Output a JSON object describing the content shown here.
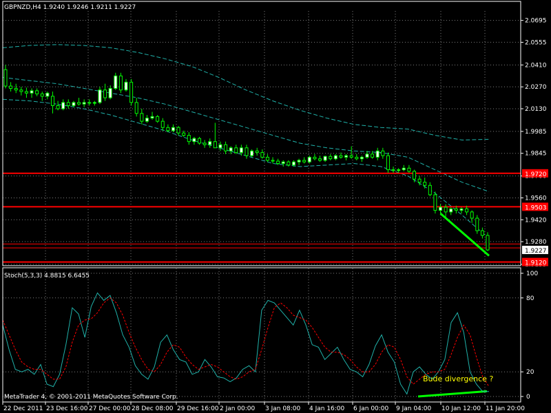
{
  "main_header": "GBPNZD,H4  1.9240 1.9246 1.9211 1.9227",
  "stoch_header": "Stoch(5,3,3) 4.8815 6.6455",
  "copyright": "MetaTrader 4, © 2001-2011 MetaQuotes Software Corp.",
  "annotation": "Bude divergence ?",
  "colors": {
    "background": "#000000",
    "grid": "#808080",
    "bull_candle": "#ffffff",
    "bear_candle": "#000000",
    "wick": "#00ff00",
    "bands": "#20b2aa",
    "level_line": "#ff0000",
    "trend_line": "#00ff00",
    "stoch_main": "#20b2aa",
    "stoch_signal": "#ff0000",
    "annotation": "#ffff00"
  },
  "chart_data": [
    {
      "type": "candlestick",
      "symbol": "GBPNZD",
      "timeframe": "H4",
      "ylim": [
        1.9135,
        2.0755
      ],
      "y_ticks": [
        "2.0695",
        "2.0555",
        "2.0410",
        "2.0270",
        "2.0130",
        "1.9985",
        "1.9845",
        "1.9700",
        "1.9560",
        "1.9420",
        "1.9280",
        "1.9135"
      ],
      "x_ticks": [
        "22 Dec 2011",
        "23 Dec 16:00",
        "27 Dec 00:00",
        "28 Dec 08:00",
        "29 Dec 16:00",
        "2 Jan 00:00",
        "3 Jan 08:00",
        "4 Jan 16:00",
        "6 Jan 00:00",
        "9 Jan 04:00",
        "10 Jan 12:00",
        "11 Jan 20:00"
      ],
      "price_labels": [
        "1.9720",
        "1.9503",
        "1.9227",
        "1.9120"
      ],
      "horizontal_levels": [
        1.9717,
        1.9503,
        1.9265,
        1.924,
        1.915
      ],
      "candles": [
        [
          2.038,
          2.041,
          2.026,
          2.0275
        ],
        [
          2.0275,
          2.03,
          2.024,
          2.026
        ],
        [
          2.026,
          2.029,
          2.023,
          2.025
        ],
        [
          2.025,
          2.027,
          2.0215,
          2.024
        ],
        [
          2.024,
          2.0265,
          2.02,
          2.023
        ],
        [
          2.023,
          2.026,
          2.02,
          2.0245
        ],
        [
          2.0245,
          2.026,
          2.021,
          2.0225
        ],
        [
          2.0225,
          2.024,
          2.018,
          2.021
        ],
        [
          2.021,
          2.024,
          2.019,
          2.023
        ],
        [
          2.021,
          2.024,
          2.01,
          2.015
        ],
        [
          2.015,
          2.018,
          2.012,
          2.013
        ],
        [
          2.013,
          2.019,
          2.012,
          2.017
        ],
        [
          2.017,
          2.019,
          2.013,
          2.015
        ],
        [
          2.015,
          2.018,
          2.014,
          2.017
        ],
        [
          2.017,
          2.02,
          2.015,
          2.016
        ],
        [
          2.016,
          2.019,
          2.014,
          2.017
        ],
        [
          2.017,
          2.019,
          2.015,
          2.0165
        ],
        [
          2.0165,
          2.018,
          2.015,
          2.017
        ],
        [
          2.017,
          2.027,
          2.016,
          2.025
        ],
        [
          2.025,
          2.029,
          2.018,
          2.02
        ],
        [
          2.02,
          2.028,
          2.019,
          2.026
        ],
        [
          2.026,
          2.036,
          2.025,
          2.034
        ],
        [
          2.034,
          2.036,
          2.023,
          2.025
        ],
        [
          2.025,
          2.032,
          2.024,
          2.03
        ],
        [
          2.03,
          2.032,
          2.015,
          2.017
        ],
        [
          2.017,
          2.02,
          2.008,
          2.01
        ],
        [
          2.01,
          2.013,
          2.003,
          2.005
        ],
        [
          2.005,
          2.009,
          2.004,
          2.007
        ],
        [
          2.007,
          2.011,
          2.006,
          2.008
        ],
        [
          2.008,
          2.009,
          2.004,
          2.005
        ],
        [
          2.005,
          2.007,
          1.999,
          2.001
        ],
        [
          2.001,
          2.003,
          1.998,
          1.999
        ],
        [
          1.999,
          2.003,
          1.998,
          2.001
        ],
        [
          2.001,
          2.002,
          1.996,
          1.9975
        ],
        [
          1.9975,
          1.999,
          1.995,
          1.996
        ],
        [
          1.996,
          1.998,
          1.99,
          1.992
        ],
        [
          1.992,
          1.995,
          1.99,
          1.994
        ],
        [
          1.994,
          1.995,
          1.99,
          1.991
        ],
        [
          1.991,
          1.993,
          1.988,
          1.99
        ],
        [
          1.99,
          1.994,
          1.988,
          1.992
        ],
        [
          1.992,
          2.004,
          1.988,
          1.988
        ],
        [
          1.988,
          1.992,
          1.986,
          1.99
        ],
        [
          1.99,
          1.992,
          1.984,
          1.986
        ],
        [
          1.986,
          1.989,
          1.984,
          1.988
        ],
        [
          1.988,
          1.99,
          1.984,
          1.985
        ],
        [
          1.985,
          1.99,
          1.983,
          1.988
        ],
        [
          1.988,
          1.99,
          1.981,
          1.983
        ],
        [
          1.983,
          1.987,
          1.982,
          1.986
        ],
        [
          1.986,
          1.988,
          1.983,
          1.985
        ],
        [
          1.985,
          1.987,
          1.981,
          1.982
        ],
        [
          1.982,
          1.984,
          1.979,
          1.98
        ],
        [
          1.98,
          1.982,
          1.978,
          1.9795
        ],
        [
          1.9795,
          1.981,
          1.977,
          1.978
        ],
        [
          1.978,
          1.98,
          1.976,
          1.979
        ],
        [
          1.979,
          1.98,
          1.976,
          1.977
        ],
        [
          1.977,
          1.98,
          1.976,
          1.979
        ],
        [
          1.979,
          1.981,
          1.977,
          1.98
        ],
        [
          1.98,
          1.982,
          1.978,
          1.979
        ],
        [
          1.979,
          1.983,
          1.978,
          1.982
        ],
        [
          1.982,
          1.984,
          1.98,
          1.981
        ],
        [
          1.981,
          1.983,
          1.979,
          1.98
        ],
        [
          1.98,
          1.983,
          1.979,
          1.9825
        ],
        [
          1.9825,
          1.984,
          1.98,
          1.981
        ],
        [
          1.981,
          1.984,
          1.98,
          1.983
        ],
        [
          1.983,
          1.985,
          1.981,
          1.982
        ],
        [
          1.982,
          1.984,
          1.98,
          1.983
        ],
        [
          1.983,
          1.989,
          1.981,
          1.982
        ],
        [
          1.982,
          1.984,
          1.98,
          1.981
        ],
        [
          1.981,
          1.983,
          1.979,
          1.982
        ],
        [
          1.982,
          1.986,
          1.981,
          1.984
        ],
        [
          1.984,
          1.986,
          1.981,
          1.982
        ],
        [
          1.982,
          1.988,
          1.98,
          1.986
        ],
        [
          1.986,
          1.988,
          1.981,
          1.983
        ],
        [
          1.983,
          1.985,
          1.972,
          1.974
        ],
        [
          1.974,
          1.976,
          1.972,
          1.9735
        ],
        [
          1.9735,
          1.975,
          1.972,
          1.974
        ],
        [
          1.974,
          1.977,
          1.973,
          1.975
        ],
        [
          1.975,
          1.977,
          1.972,
          1.973
        ],
        [
          1.973,
          1.974,
          1.966,
          1.968
        ],
        [
          1.968,
          1.97,
          1.964,
          1.966
        ],
        [
          1.966,
          1.969,
          1.962,
          1.964
        ],
        [
          1.964,
          1.966,
          1.957,
          1.958
        ],
        [
          1.958,
          1.96,
          1.946,
          1.948
        ],
        [
          1.948,
          1.952,
          1.946,
          1.95
        ],
        [
          1.95,
          1.952,
          1.944,
          1.947
        ],
        [
          1.947,
          1.95,
          1.945,
          1.949
        ],
        [
          1.949,
          1.951,
          1.946,
          1.948
        ],
        [
          1.948,
          1.95,
          1.946,
          1.949
        ],
        [
          1.949,
          1.951,
          1.945,
          1.947
        ],
        [
          1.947,
          1.948,
          1.94,
          1.943
        ],
        [
          1.943,
          1.945,
          1.933,
          1.935
        ],
        [
          1.935,
          1.937,
          1.93,
          1.932
        ],
        [
          1.932,
          1.934,
          1.922,
          1.9227
        ]
      ],
      "bands": {
        "upper": [
          2.052,
          2.0535,
          2.054,
          2.0535,
          2.052,
          2.049,
          2.045,
          2.04,
          2.033,
          2.025,
          2.018,
          2.012,
          2.007,
          2.003,
          2.001,
          2.0,
          1.996,
          1.993,
          1.9935
        ],
        "middle": [
          2.033,
          2.031,
          2.029,
          2.026,
          2.023,
          2.02,
          2.016,
          2.011,
          2.006,
          2.001,
          1.996,
          1.991,
          1.988,
          1.986,
          1.985,
          1.982,
          1.974,
          1.966,
          1.96
        ],
        "lower": [
          2.019,
          2.018,
          2.016,
          2.013,
          2.009,
          2.004,
          1.999,
          1.993,
          1.988,
          1.983,
          1.978,
          1.976,
          1.977,
          1.978,
          1.976,
          1.97,
          1.959,
          1.945,
          1.93
        ]
      },
      "trend_line": {
        "from": [
          83,
          1.946
        ],
        "to": [
          92,
          1.919
        ]
      }
    },
    {
      "type": "line",
      "name": "Stoch(5,3,3)",
      "ylim": [
        0,
        100
      ],
      "y_ticks": [
        "100",
        "80",
        "20",
        "0"
      ],
      "series": [
        {
          "values": [
            58,
            38,
            22,
            20,
            22,
            18,
            26,
            10,
            8,
            18,
            42,
            72,
            67,
            48,
            73,
            84,
            78,
            82,
            68,
            50,
            40,
            25,
            18,
            14,
            24,
            44,
            50,
            38,
            30,
            28,
            18,
            20,
            30,
            24,
            16,
            15,
            12,
            15,
            22,
            25,
            20,
            70,
            78,
            76,
            70,
            64,
            58,
            70,
            58,
            42,
            40,
            30,
            35,
            40,
            30,
            22,
            20,
            16,
            26,
            41,
            50,
            36,
            28,
            10,
            2,
            20,
            24,
            18,
            14,
            20,
            30,
            60,
            68,
            52,
            20,
            10,
            4,
            4
          ]
        },
        {
          "values": [
            62,
            50,
            38,
            28,
            24,
            22,
            22,
            18,
            14,
            14,
            24,
            44,
            58,
            62,
            63,
            68,
            76,
            80,
            76,
            66,
            52,
            40,
            30,
            22,
            20,
            26,
            36,
            42,
            40,
            32,
            26,
            22,
            24,
            26,
            24,
            20,
            16,
            14,
            16,
            20,
            22,
            38,
            56,
            72,
            76,
            72,
            66,
            64,
            62,
            56,
            48,
            40,
            36,
            36,
            34,
            30,
            24,
            20,
            20,
            26,
            36,
            42,
            40,
            30,
            16,
            10,
            14,
            18,
            20,
            20,
            22,
            34,
            48,
            58,
            50,
            32,
            16,
            8
          ]
        }
      ],
      "trend_line": {
        "from": [
          607,
          0
        ],
        "to": [
          707,
          2
        ]
      }
    }
  ]
}
